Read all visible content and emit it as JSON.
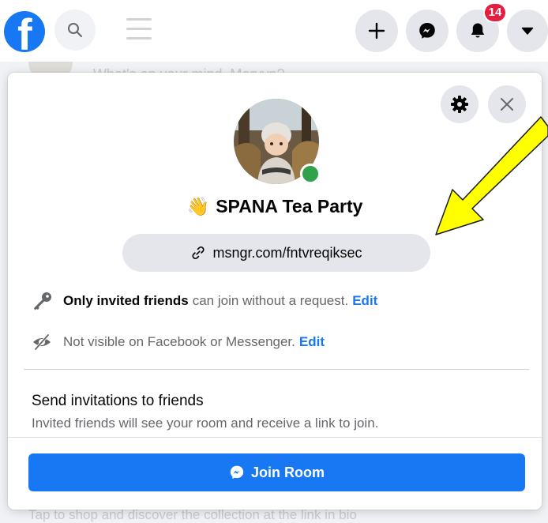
{
  "topbar": {
    "notifications_badge": "14",
    "icons": [
      "facebook-logo",
      "search-icon",
      "menu-icon",
      "plus-icon",
      "messenger-icon",
      "bell-icon",
      "caret-down-icon"
    ]
  },
  "background": {
    "top_text": "What's on your mind, Mervyn?",
    "bottom_text": "Tap to shop and discover the collection at the link in bio"
  },
  "room": {
    "emoji": "👋",
    "name": "SPANA Tea Party",
    "link": "msngr.com/fntvreqiksec",
    "access_bold": "Only invited friends",
    "access_rest": "can join without a request.",
    "access_edit": "Edit",
    "visibility_text": "Not visible on Facebook or Messenger.",
    "visibility_edit": "Edit",
    "invite_title": "Send invitations to friends",
    "invite_subtitle": "Invited friends will see your room and receive a link to join.",
    "join_label": "Join Room"
  },
  "colors": {
    "brand_blue": "#1877f2",
    "online_green": "#31a24c",
    "badge_red": "#e41e3f",
    "annotation_arrow": "#ffff00"
  }
}
